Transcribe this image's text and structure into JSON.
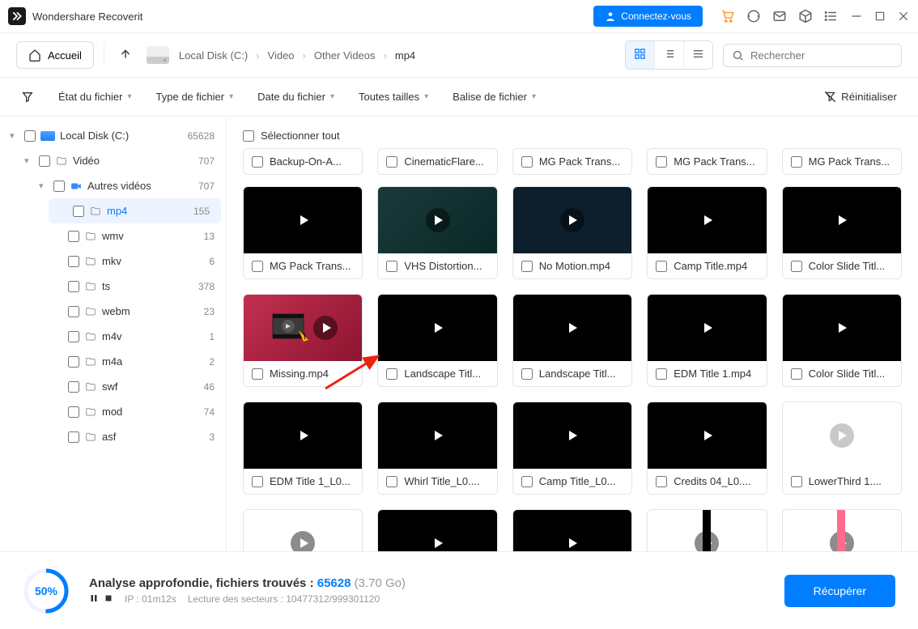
{
  "app": {
    "title": "Wondershare Recoverit"
  },
  "titlebar": {
    "connect": "Connectez-vous"
  },
  "toolbar": {
    "home": "Accueil",
    "crumbs": [
      "Local Disk (C:)",
      "Video",
      "Other Videos",
      "mp4"
    ],
    "search_placeholder": "Rechercher"
  },
  "filters": {
    "state": "État du fichier",
    "type": "Type de fichier",
    "date": "Date du fichier",
    "size": "Toutes tailles",
    "tag": "Balise de fichier",
    "reset": "Réinitialiser"
  },
  "tree": [
    {
      "label": "Local Disk (C:)",
      "count": "65628",
      "depth": 0,
      "icon": "disk",
      "caret": "▾"
    },
    {
      "label": "Vidéo",
      "count": "707",
      "depth": 1,
      "icon": "folder",
      "caret": "▾"
    },
    {
      "label": "Autres vidéos",
      "count": "707",
      "depth": 2,
      "icon": "video",
      "caret": "▾"
    },
    {
      "label": "mp4",
      "count": "155",
      "depth": 3,
      "icon": "folder",
      "selected": true
    },
    {
      "label": "wmv",
      "count": "13",
      "depth": 3,
      "icon": "folder"
    },
    {
      "label": "mkv",
      "count": "6",
      "depth": 3,
      "icon": "folder"
    },
    {
      "label": "ts",
      "count": "378",
      "depth": 3,
      "icon": "folder"
    },
    {
      "label": "webm",
      "count": "23",
      "depth": 3,
      "icon": "folder"
    },
    {
      "label": "m4v",
      "count": "1",
      "depth": 3,
      "icon": "folder"
    },
    {
      "label": "m4a",
      "count": "2",
      "depth": 3,
      "icon": "folder"
    },
    {
      "label": "swf",
      "count": "46",
      "depth": 3,
      "icon": "folder"
    },
    {
      "label": "mod",
      "count": "74",
      "depth": 3,
      "icon": "folder"
    },
    {
      "label": "asf",
      "count": "3",
      "depth": 3,
      "icon": "folder"
    }
  ],
  "select_all": "Sélectionner tout",
  "top_row": [
    "Backup-On-A...",
    "CinematicFlare...",
    "MG Pack Trans...",
    "MG Pack Trans...",
    "MG Pack Trans..."
  ],
  "thumbs": [
    [
      {
        "n": "MG Pack Trans...",
        "v": "black"
      },
      {
        "n": "VHS Distortion...",
        "v": "vhs"
      },
      {
        "n": "No Motion.mp4",
        "v": "nomotion"
      },
      {
        "n": "Camp Title.mp4",
        "v": "black"
      },
      {
        "n": "Color Slide Titl...",
        "v": "black"
      }
    ],
    [
      {
        "n": "Missing.mp4",
        "v": "missing"
      },
      {
        "n": "Landscape Titl...",
        "v": "black"
      },
      {
        "n": "Landscape Titl...",
        "v": "black"
      },
      {
        "n": "EDM Title 1.mp4",
        "v": "black"
      },
      {
        "n": "Color Slide Titl...",
        "v": "black"
      }
    ],
    [
      {
        "n": "EDM Title 1_L0...",
        "v": "black"
      },
      {
        "n": "Whirl Title_L0....",
        "v": "black"
      },
      {
        "n": "Camp Title_L0...",
        "v": "black"
      },
      {
        "n": "Credits 04_L0....",
        "v": "black"
      },
      {
        "n": "LowerThird 1....",
        "v": "wb3"
      }
    ],
    [
      {
        "n": "",
        "v": "teal"
      },
      {
        "n": "",
        "v": "black"
      },
      {
        "n": "",
        "v": "black"
      },
      {
        "n": "",
        "v": "wb1"
      },
      {
        "n": "",
        "v": "wb2"
      }
    ]
  ],
  "footer": {
    "percent": "50%",
    "line1a": "Analyse approfondie, fichiers trouvés : ",
    "found": "65628",
    "size": "(3.70 Go)",
    "ip_label": "IP : 01m12s",
    "sectors": "Lecture des secteurs : 10477312/999301120",
    "recover": "Récupérer"
  }
}
